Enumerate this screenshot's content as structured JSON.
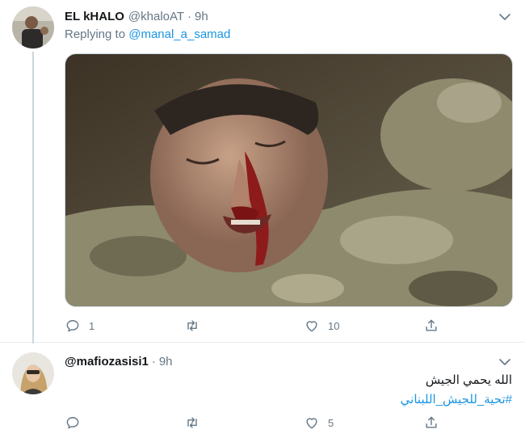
{
  "tweet1": {
    "display_name": "EL kHALO",
    "handle": "@khaloAT",
    "separator": "·",
    "time": "9h",
    "replying_prefix": "Replying to",
    "replying_to": "@manal_a_samad",
    "actions": {
      "reply_count": "1",
      "retweet_count": "",
      "like_count": "10"
    }
  },
  "tweet2": {
    "handle": "@mafiozasisi1",
    "separator": "·",
    "time": "9h",
    "text": "الله يحمي الجيش",
    "hashtag": "#تحية_للجيش_اللبناني",
    "actions": {
      "reply_count": "",
      "retweet_count": "",
      "like_count": "5"
    }
  },
  "icons": {
    "reply": "reply-icon",
    "retweet": "retweet-icon",
    "like": "like-icon",
    "share": "share-icon",
    "caret": "chevron-down-icon"
  },
  "colors": {
    "link": "#1b95e0",
    "secondary_text": "#657786",
    "thread_line": "#ccd6dd"
  }
}
